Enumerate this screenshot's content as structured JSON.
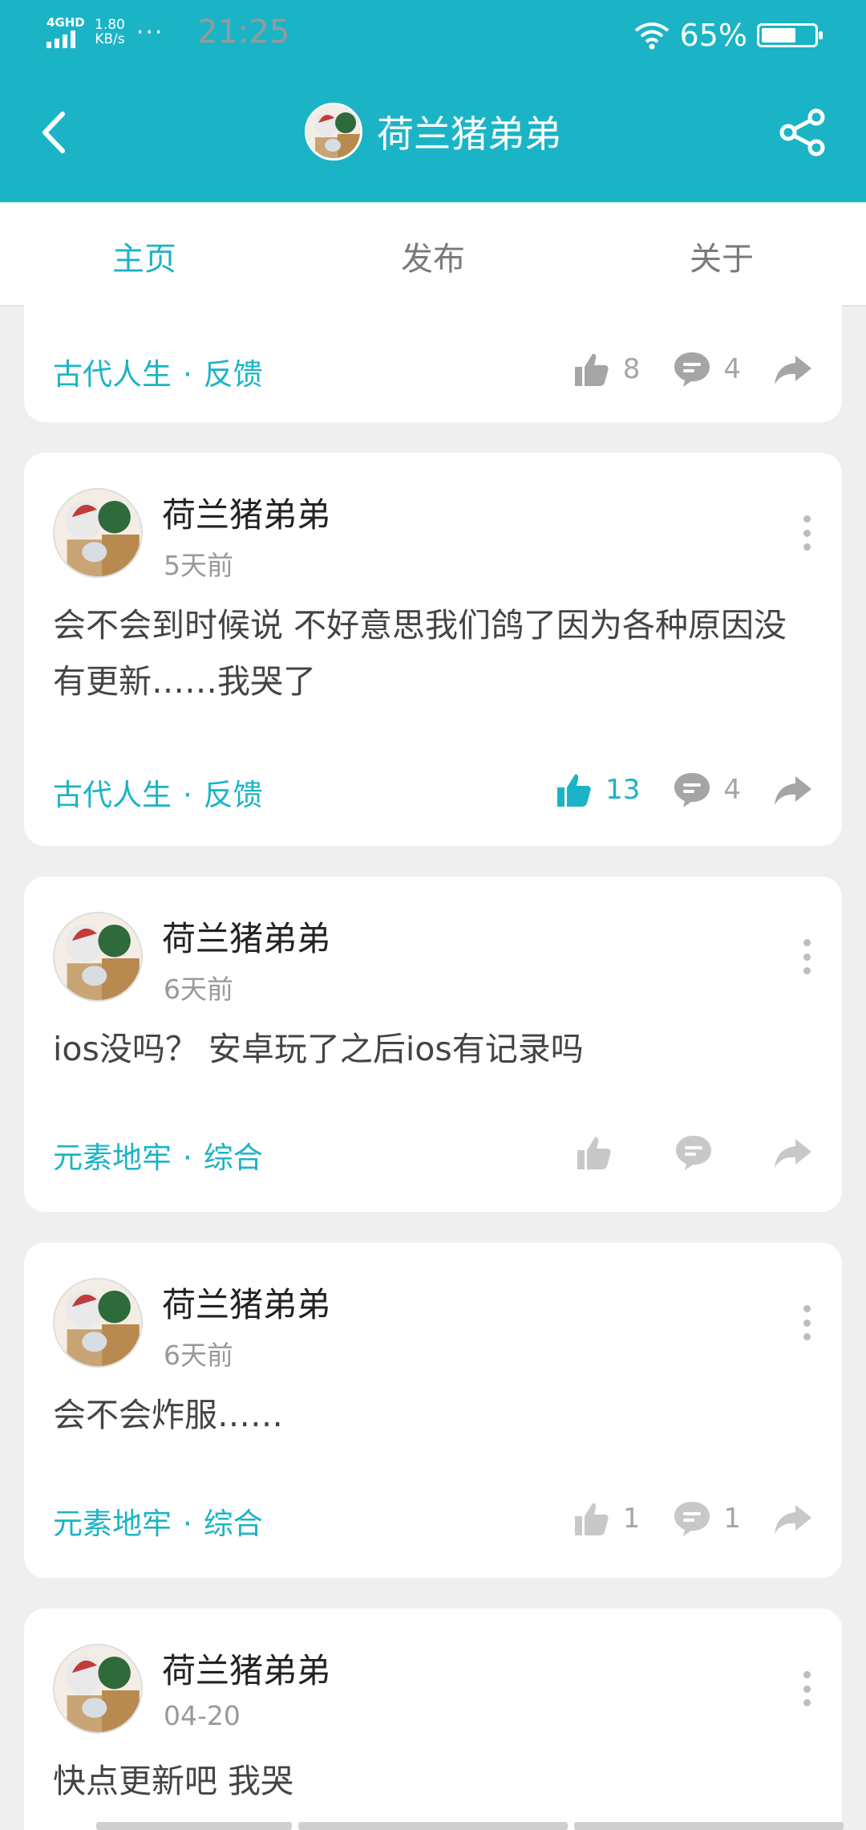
{
  "status_bar": {
    "network": "4GHD",
    "time": "21:25",
    "speed_value": "1.80",
    "speed_unit": "KB/s",
    "more": "···",
    "battery_percent": "65%",
    "battery_level": 0.65
  },
  "header": {
    "title": "荷兰猪弟弟",
    "back_icon": "chevron-left-icon",
    "share_icon": "share-icon"
  },
  "tabs": [
    {
      "label": "主页",
      "active": true
    },
    {
      "label": "发布",
      "active": false
    },
    {
      "label": "关于",
      "active": false
    }
  ],
  "posts": [
    {
      "partial": true,
      "tag_game": "古代人生",
      "tag_sep": "·",
      "tag_category": "反馈",
      "likes": "8",
      "comments": "4",
      "liked": false
    },
    {
      "author": "荷兰猪弟弟",
      "time": "5天前",
      "content": "会不会到时候说 不好意思我们鸽了因为各种原因没有更新……我哭了",
      "tag_game": "古代人生",
      "tag_sep": "·",
      "tag_category": "反馈",
      "likes": "13",
      "comments": "4",
      "liked": true
    },
    {
      "author": "荷兰猪弟弟",
      "time": "6天前",
      "content": "ios没吗？ 安卓玩了之后ios有记录吗",
      "tag_game": "元素地牢",
      "tag_sep": "·",
      "tag_category": "综合",
      "likes": "",
      "comments": "",
      "liked": false
    },
    {
      "author": "荷兰猪弟弟",
      "time": "6天前",
      "content": "会不会炸服……",
      "tag_game": "元素地牢",
      "tag_sep": "·",
      "tag_category": "综合",
      "likes": "1",
      "comments": "1",
      "liked": false
    },
    {
      "author": "荷兰猪弟弟",
      "time": "04-20",
      "content": "快点更新吧 我哭",
      "partial": true
    }
  ],
  "colors": {
    "accent": "#1bb4c6",
    "background": "#efefef",
    "card": "#ffffff",
    "muted": "#a5a5a5"
  }
}
